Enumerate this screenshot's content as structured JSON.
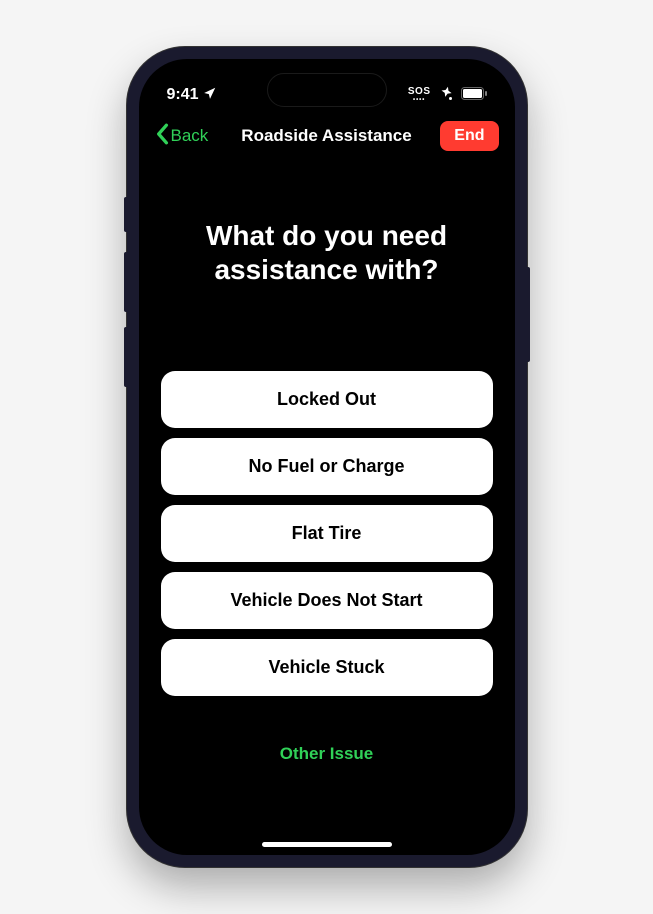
{
  "status": {
    "time": "9:41",
    "sos": "SOS"
  },
  "nav": {
    "back_label": "Back",
    "title": "Roadside Assistance",
    "end_label": "End"
  },
  "main": {
    "heading": "What do you need assistance with?",
    "options": [
      "Locked Out",
      "No Fuel or Charge",
      "Flat Tire",
      "Vehicle Does Not Start",
      "Vehicle Stuck"
    ],
    "other_label": "Other Issue"
  },
  "colors": {
    "accent_green": "#30d158",
    "destructive_red": "#ff3b30"
  }
}
